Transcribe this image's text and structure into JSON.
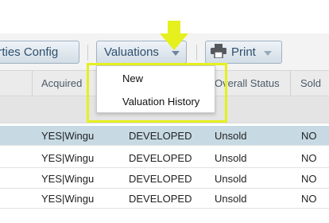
{
  "toolbar": {
    "properties_config_label": "erties Config",
    "valuations_label": "Valuations",
    "print_label": "Print"
  },
  "table": {
    "columns": [
      "Acquired",
      "Overall Status",
      "Sold"
    ],
    "rows": [
      {
        "acquired": "YES|Wingu",
        "development": "DEVELOPED",
        "overall_status": "Unsold",
        "sold": "NO"
      },
      {
        "acquired": "YES|Wingu",
        "development": "DEVELOPED",
        "overall_status": "Unsold",
        "sold": "NO"
      },
      {
        "acquired": "YES|Wingu",
        "development": "DEVELOPED",
        "overall_status": "Unsold",
        "sold": "NO"
      },
      {
        "acquired": "YES|Wingu",
        "development": "DEVELOPED",
        "overall_status": "Unsold",
        "sold": "NO"
      }
    ]
  },
  "dropdown": {
    "items": [
      "New",
      "Valuation History"
    ]
  },
  "colors": {
    "highlight": "#e5f01e",
    "selected_row": "#c7dae4",
    "button_text": "#2f4f6f"
  },
  "icons": [
    "print-icon",
    "chevron-down-icon",
    "pointer-arrow-icon"
  ]
}
